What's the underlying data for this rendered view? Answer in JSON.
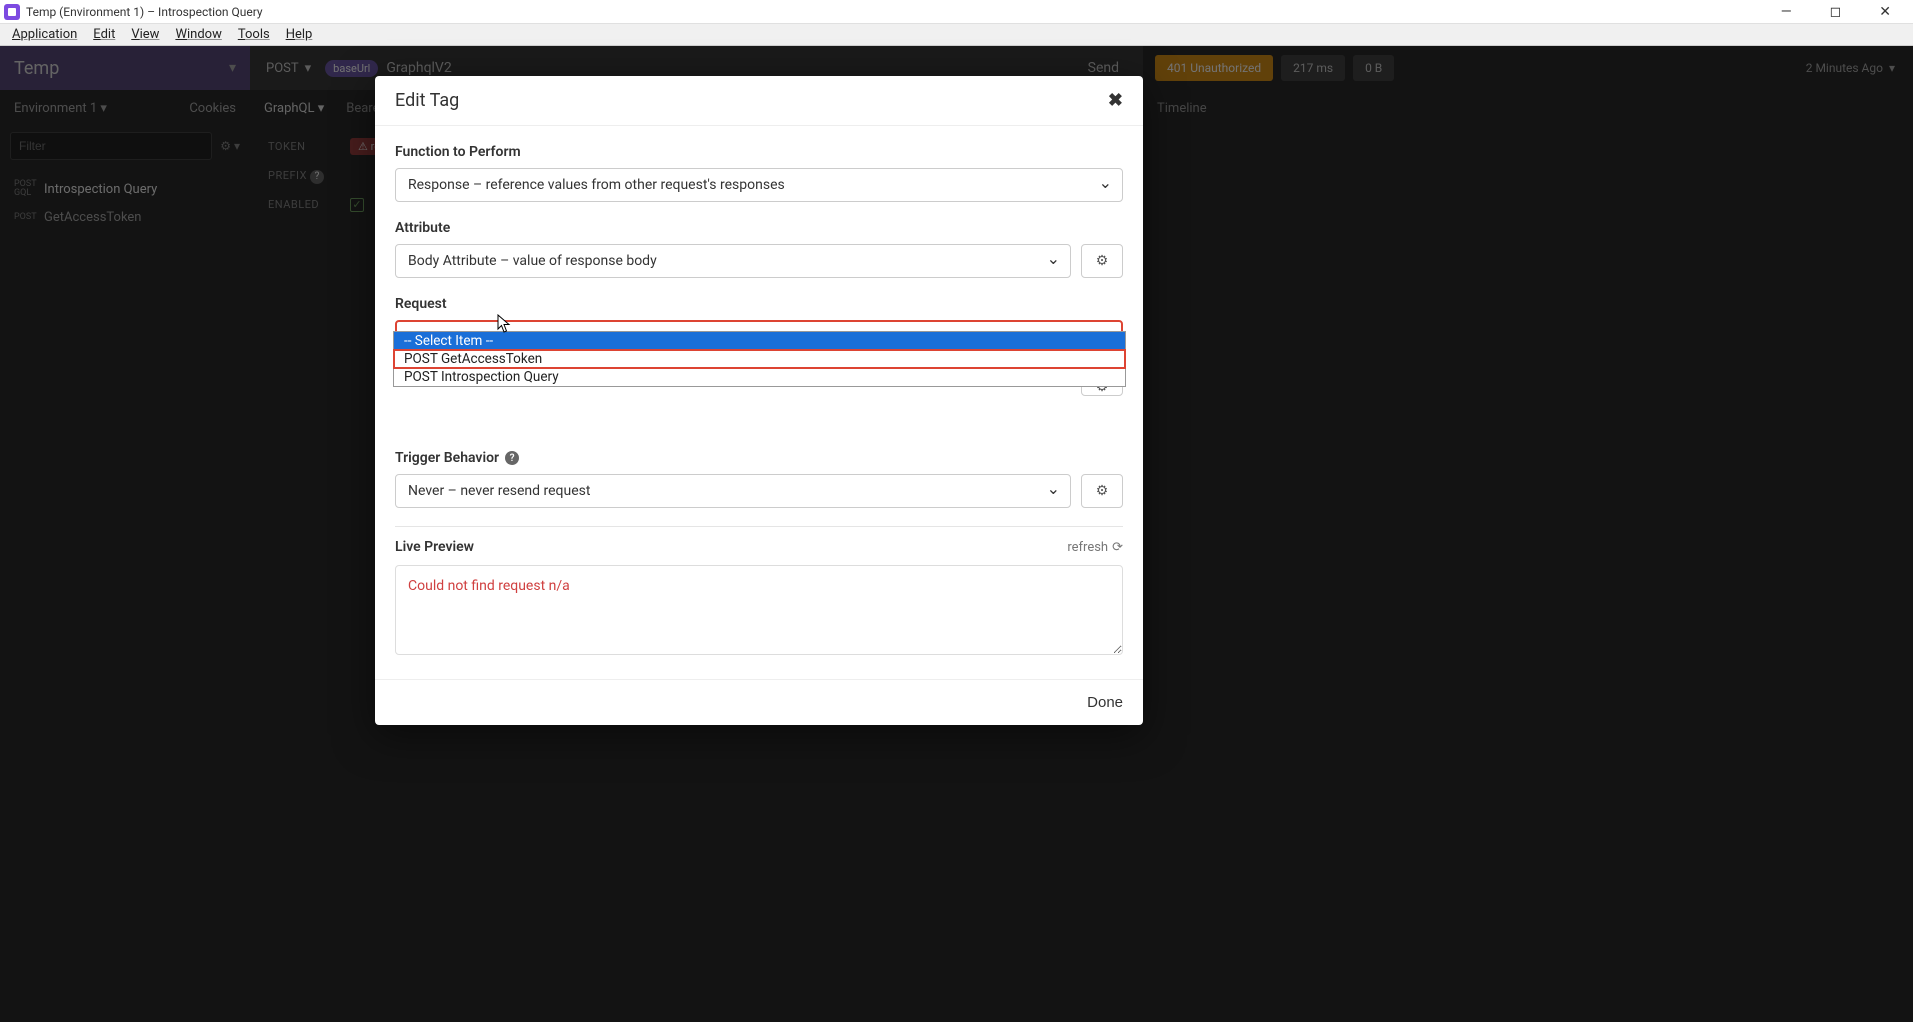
{
  "window": {
    "title": "Temp (Environment 1) – Introspection Query"
  },
  "menu": {
    "application": "Application",
    "edit": "Edit",
    "view": "View",
    "window": "Window",
    "tools": "Tools",
    "help": "Help"
  },
  "sidebar": {
    "workspace": "Temp",
    "env": "Environment 1",
    "cookies": "Cookies",
    "filter_placeholder": "Filter",
    "items": [
      {
        "method": "POST GQL",
        "label": "Introspection Query"
      },
      {
        "method": "POST",
        "label": "GetAccessToken"
      }
    ]
  },
  "request": {
    "method": "POST",
    "base_tag": "baseUrl",
    "url_suffix": "GraphqlV2",
    "send": "Send",
    "tabs": {
      "graphql": "GraphQL",
      "bearer": "Bearer"
    },
    "form": {
      "token_label": "TOKEN",
      "token_tag": "⚠ respo",
      "prefix_label": "PREFIX",
      "enabled_label": "ENABLED"
    }
  },
  "response": {
    "status": "401 Unauthorized",
    "time": "217 ms",
    "size": "0 B",
    "ago": "2 Minutes Ago",
    "tabs": {
      "timeline": "Timeline"
    }
  },
  "modal": {
    "title": "Edit Tag",
    "fn_label": "Function to Perform",
    "fn_value": "Response – reference values from other request's responses",
    "attr_label": "Attribute",
    "attr_value": "Body Attribute – value of response body",
    "req_label": "Request",
    "req_value": "-- Select Item --",
    "trigger_label": "Trigger Behavior",
    "trigger_value": "Never – never resend request",
    "live_label": "Live Preview",
    "refresh": "refresh",
    "preview_text": "Could not find request n/a",
    "done": "Done",
    "dropdown": {
      "opt0": "-- Select Item --",
      "opt1": "POST GetAccessToken",
      "opt2": "POST Introspection Query"
    }
  }
}
